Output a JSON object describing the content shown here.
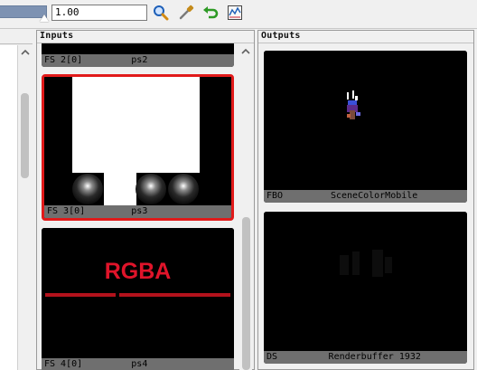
{
  "toolbar": {
    "range_value": "1.00",
    "icons": [
      "zoom-icon",
      "color-picker-icon",
      "refresh-icon",
      "range-histogram-icon"
    ]
  },
  "inputs_panel": {
    "title": "Inputs",
    "items": [
      {
        "slot": "FS 2[0]",
        "name": "ps2"
      },
      {
        "slot": "FS 3[0]",
        "name": "ps3",
        "selected": true
      },
      {
        "slot": "FS 4[0]",
        "name": "ps4",
        "overlay_text": "RGBA"
      }
    ]
  },
  "outputs_panel": {
    "title": "Outputs",
    "items": [
      {
        "slot": "FBO",
        "name": "SceneColorMobile"
      },
      {
        "slot": "DS",
        "name": "Renderbuffer 1932"
      }
    ]
  },
  "colors": {
    "selection": "#e11a1a",
    "rgba_text": "#e0142a",
    "caption_bg": "#6f6f6f"
  }
}
